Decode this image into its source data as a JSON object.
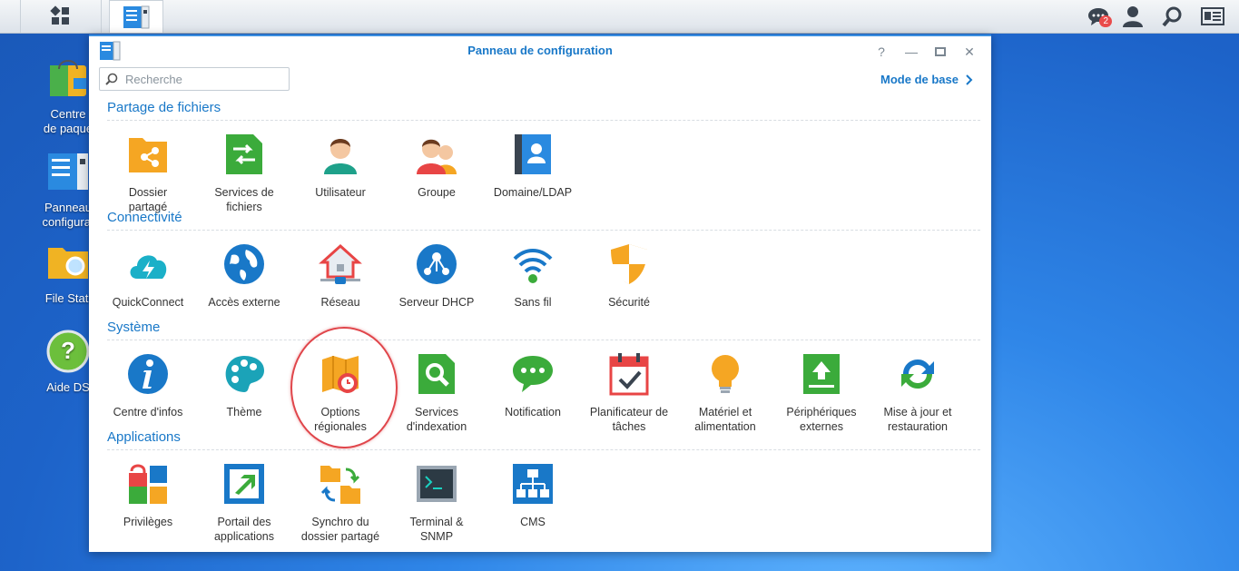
{
  "taskbar": {
    "notifications_count": "2"
  },
  "desktop": {
    "items": [
      {
        "label1": "Centre",
        "label2": "de paque"
      },
      {
        "label1": "Panneau",
        "label2": "configurat"
      },
      {
        "label1": "File Stati",
        "label2": ""
      },
      {
        "label1": "Aide DS",
        "label2": ""
      }
    ]
  },
  "window": {
    "title": "Panneau de configuration",
    "search_placeholder": "Recherche",
    "mode_label": "Mode de base",
    "sections": [
      {
        "title": "Partage de fichiers",
        "items": [
          {
            "l1": "Dossier",
            "l2": "partagé"
          },
          {
            "l1": "Services de",
            "l2": "fichiers"
          },
          {
            "l1": "Utilisateur",
            "l2": ""
          },
          {
            "l1": "Groupe",
            "l2": ""
          },
          {
            "l1": "Domaine/LDAP",
            "l2": ""
          }
        ]
      },
      {
        "title": "Connectivité",
        "items": [
          {
            "l1": "QuickConnect",
            "l2": ""
          },
          {
            "l1": "Accès externe",
            "l2": ""
          },
          {
            "l1": "Réseau",
            "l2": ""
          },
          {
            "l1": "Serveur DHCP",
            "l2": ""
          },
          {
            "l1": "Sans fil",
            "l2": ""
          },
          {
            "l1": "Sécurité",
            "l2": ""
          }
        ]
      },
      {
        "title": "Système",
        "items": [
          {
            "l1": "Centre d'infos",
            "l2": ""
          },
          {
            "l1": "Thème",
            "l2": ""
          },
          {
            "l1": "Options",
            "l2": "régionales"
          },
          {
            "l1": "Services",
            "l2": "d'indexation"
          },
          {
            "l1": "Notification",
            "l2": ""
          },
          {
            "l1": "Planificateur de",
            "l2": "tâches"
          },
          {
            "l1": "Matériel et",
            "l2": "alimentation"
          },
          {
            "l1": "Périphériques",
            "l2": "externes"
          },
          {
            "l1": "Mise à jour et",
            "l2": "restauration"
          }
        ]
      },
      {
        "title": "Applications",
        "items": [
          {
            "l1": "Privilèges",
            "l2": ""
          },
          {
            "l1": "Portail des",
            "l2": "applications"
          },
          {
            "l1": "Synchro du",
            "l2": "dossier partagé"
          },
          {
            "l1": "Terminal &",
            "l2": "SNMP"
          },
          {
            "l1": "CMS",
            "l2": ""
          }
        ]
      }
    ]
  },
  "colors": {
    "accent": "#1978c8",
    "highlight": "#e0464b"
  }
}
